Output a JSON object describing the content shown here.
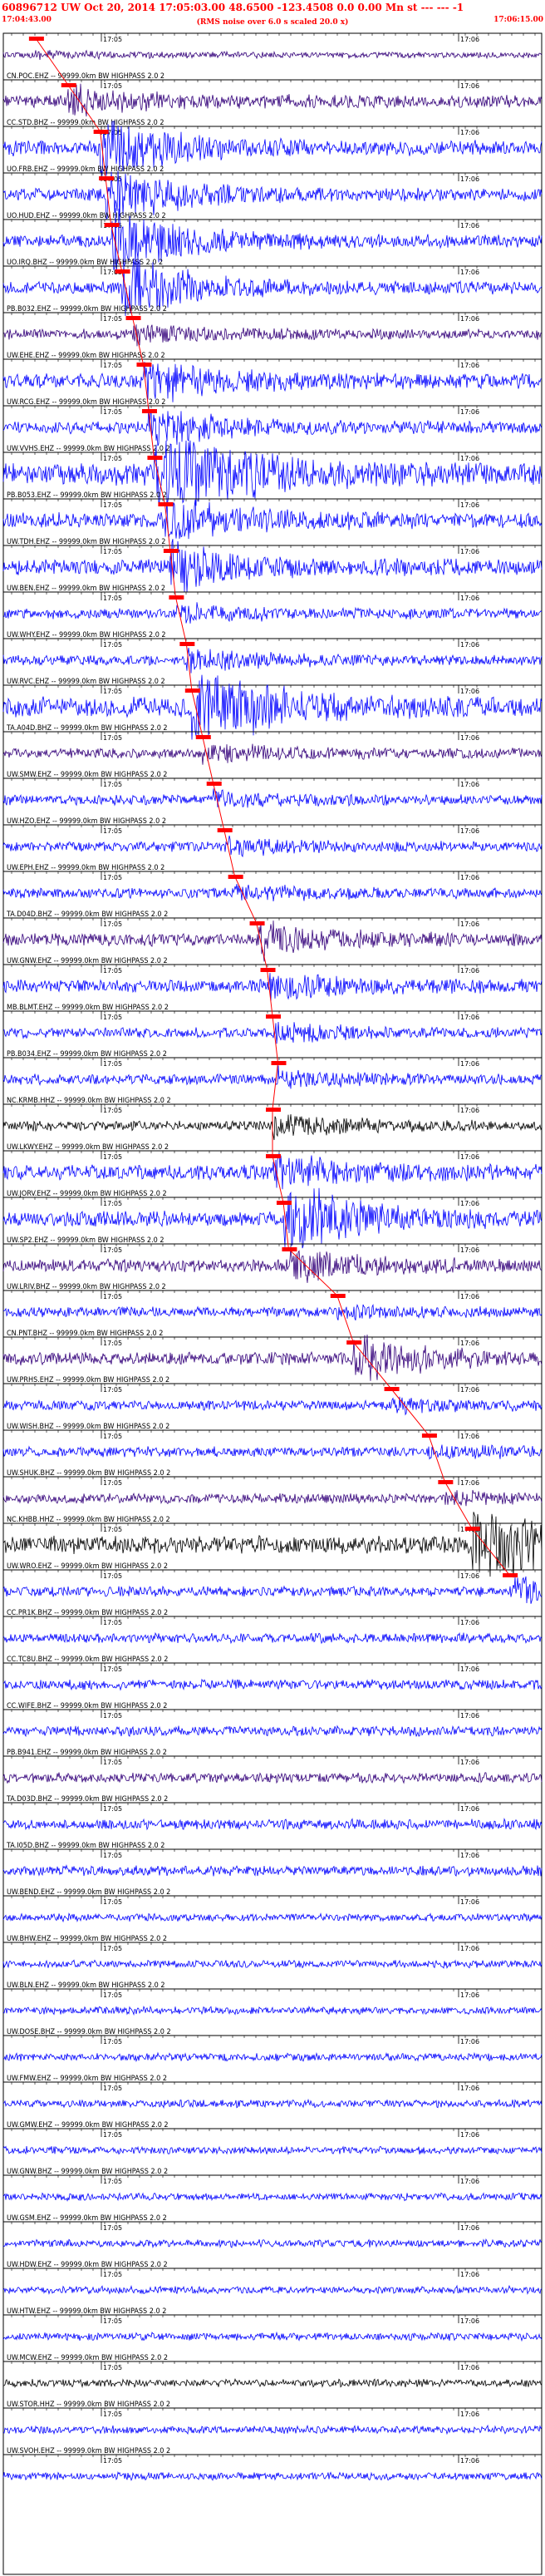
{
  "header": {
    "title": "60896712 UW Oct 20, 2014 17:05:03.00   48.6500 -123.4508  0.0 0.00 Mn st --- --- -1",
    "start_time": "17:04:43.00",
    "rms_note": "(RMS noise over 6.0 s scaled 20.0 x)",
    "end_time": "17:06:15.00"
  },
  "time_ticks": [
    "17:05",
    "17:06"
  ],
  "colors": {
    "header": "#ff0000",
    "pick": "#ff0000",
    "blue": "#0000ff",
    "black": "#000000",
    "purple": "#33007a"
  },
  "channels": [
    {
      "label": "",
      "color": "purple",
      "amp": 0.12,
      "pick": 0.06,
      "ev": 0.3
    },
    {
      "label": "CN.POC.EHZ -- 99999.0km BW HIGHPASS  2.0  2",
      "color": "purple",
      "amp": 0.25,
      "pick": 0.12,
      "ev": 0.6
    },
    {
      "label": "CC.STD.BHZ -- 99999.0km BW HIGHPASS  2.0  2",
      "color": "blue",
      "amp": 0.3,
      "pick": 0.18,
      "ev": 1.2
    },
    {
      "label": "UO.FRB.EHZ -- 99999.0km BW HIGHPASS  2.0  2",
      "color": "blue",
      "amp": 0.25,
      "pick": 0.19,
      "ev": 1.4
    },
    {
      "label": "UO.HUD.EHZ -- 99999.0km BW HIGHPASS  2.0  2",
      "color": "blue",
      "amp": 0.25,
      "pick": 0.2,
      "ev": 1.6
    },
    {
      "label": "UO.IRQ.BHZ -- 99999.0km BW HIGHPASS  2.0  2",
      "color": "blue",
      "amp": 0.25,
      "pick": 0.22,
      "ev": 1.5
    },
    {
      "label": "PB.B032.EHZ -- 99999.0km BW HIGHPASS  2.0  2",
      "color": "purple",
      "amp": 0.2,
      "pick": 0.24,
      "ev": 0.5
    },
    {
      "label": "UW.EHE.EHZ -- 99999.0km BW HIGHPASS  2.0  2",
      "color": "blue",
      "amp": 0.3,
      "pick": 0.26,
      "ev": 0.9
    },
    {
      "label": "UW.RCG.EHZ -- 99999.0km BW HIGHPASS  2.0  2",
      "color": "blue",
      "amp": 0.25,
      "pick": 0.27,
      "ev": 0.8
    },
    {
      "label": "UW.VVHS.EHZ -- 99999.0km BW HIGHPASS  2.0  2",
      "color": "blue",
      "amp": 0.45,
      "pick": 0.28,
      "ev": 1.6
    },
    {
      "label": "PB.B053.EHZ -- 99999.0km BW HIGHPASS  2.0  2",
      "color": "blue",
      "amp": 0.3,
      "pick": 0.3,
      "ev": 0.9
    },
    {
      "label": "UW.TDH.EHZ -- 99999.0km BW HIGHPASS  2.0  2",
      "color": "blue",
      "amp": 0.3,
      "pick": 0.31,
      "ev": 0.9
    },
    {
      "label": "UW.BEN.EHZ -- 99999.0km BW HIGHPASS  2.0  2",
      "color": "blue",
      "amp": 0.2,
      "pick": 0.32,
      "ev": 0.5
    },
    {
      "label": "UW.WHY.EHZ -- 99999.0km BW HIGHPASS  2.0  2",
      "color": "blue",
      "amp": 0.2,
      "pick": 0.34,
      "ev": 0.6
    },
    {
      "label": "UW.RVC.EHZ -- 99999.0km BW HIGHPASS  2.0  2",
      "color": "blue",
      "amp": 0.4,
      "pick": 0.35,
      "ev": 1.4
    },
    {
      "label": "TA.A04D.BHZ -- 99999.0km BW HIGHPASS  2.0  2",
      "color": "purple",
      "amp": 0.2,
      "pick": 0.37,
      "ev": 0.5
    },
    {
      "label": "UW.SMW.EHZ -- 99999.0km BW HIGHPASS  2.0  2",
      "color": "blue",
      "amp": 0.2,
      "pick": 0.39,
      "ev": 0.4
    },
    {
      "label": "UW.HZO.EHZ -- 99999.0km BW HIGHPASS  2.0  2",
      "color": "blue",
      "amp": 0.2,
      "pick": 0.41,
      "ev": 0.4
    },
    {
      "label": "UW.EPH.EHZ -- 99999.0km BW HIGHPASS  2.0  2",
      "color": "blue",
      "amp": 0.2,
      "pick": 0.43,
      "ev": 0.4
    },
    {
      "label": "TA.D04D.BHZ -- 99999.0km BW HIGHPASS  2.0  2",
      "color": "purple",
      "amp": 0.25,
      "pick": 0.47,
      "ev": 0.8
    },
    {
      "label": "UW.GNW.EHZ -- 99999.0km BW HIGHPASS  2.0  2",
      "color": "blue",
      "amp": 0.25,
      "pick": 0.49,
      "ev": 0.8
    },
    {
      "label": "MB.BLMT.EHZ -- 99999.0km BW HIGHPASS  2.0  2",
      "color": "blue",
      "amp": 0.2,
      "pick": 0.5,
      "ev": 0.5
    },
    {
      "label": "PB.B034.EHZ -- 99999.0km BW HIGHPASS  2.0  2",
      "color": "blue",
      "amp": 0.2,
      "pick": 0.51,
      "ev": 0.5
    },
    {
      "label": "NC.KRMB.HHZ -- 99999.0km BW HIGHPASS  2.0  2",
      "color": "black",
      "amp": 0.2,
      "pick": 0.5,
      "ev": 0.6
    },
    {
      "label": "UW.LKWY.EHZ -- 99999.0km BW HIGHPASS  2.0  2",
      "color": "blue",
      "amp": 0.3,
      "pick": 0.5,
      "ev": 0.6
    },
    {
      "label": "UW.JORV.EHZ -- 99999.0km BW HIGHPASS  2.0  2",
      "color": "blue",
      "amp": 0.3,
      "pick": 0.52,
      "ev": 1.6
    },
    {
      "label": "UW.SP2.EHZ -- 99999.0km BW HIGHPASS  2.0  2",
      "color": "purple",
      "amp": 0.25,
      "pick": 0.53,
      "ev": 0.8
    },
    {
      "label": "UW.LRIV.BHZ -- 99999.0km BW HIGHPASS  2.0  2",
      "color": "blue",
      "amp": 0.2,
      "pick": 0.62,
      "ev": 0.3
    },
    {
      "label": "CN.PNT.BHZ -- 99999.0km BW HIGHPASS  2.0  2",
      "color": "purple",
      "amp": 0.25,
      "pick": 0.65,
      "ev": 1.1
    },
    {
      "label": "UW.PRHS.EHZ -- 99999.0km BW HIGHPASS  2.0  2",
      "color": "blue",
      "amp": 0.2,
      "pick": 0.72,
      "ev": 0.3
    },
    {
      "label": "UW.WISH.BHZ -- 99999.0km BW HIGHPASS  2.0  2",
      "color": "blue",
      "amp": 0.2,
      "pick": 0.79,
      "ev": 0.3
    },
    {
      "label": "UW.SHUK.BHZ -- 99999.0km BW HIGHPASS  2.0  2",
      "color": "purple",
      "amp": 0.2,
      "pick": 0.82,
      "ev": 0.3
    },
    {
      "label": "NC.KHBB.HHZ -- 99999.0km BW HIGHPASS  2.0  2",
      "color": "black",
      "amp": 0.35,
      "pick": 0.87,
      "ev": 1.8
    },
    {
      "label": "UW.WRO.EHZ -- 99999.0km BW HIGHPASS  2.0  2",
      "color": "blue",
      "amp": 0.2,
      "pick": 0.94,
      "ev": 0.8
    },
    {
      "label": "CC.PR1K.BHZ -- 99999.0km BW HIGHPASS  2.0  2",
      "color": "blue",
      "amp": 0.2
    },
    {
      "label": "CC.TC8U.BHZ -- 99999.0km BW HIGHPASS  2.0  2",
      "color": "blue",
      "amp": 0.2
    },
    {
      "label": "CC.WIFE.BHZ -- 99999.0km BW HIGHPASS  2.0  2",
      "color": "blue",
      "amp": 0.2
    },
    {
      "label": "PB.B941.EHZ -- 99999.0km BW HIGHPASS  2.0  2",
      "color": "purple",
      "amp": 0.2
    },
    {
      "label": "TA.D03D.BHZ -- 99999.0km BW HIGHPASS  2.0  2",
      "color": "blue",
      "amp": 0.2
    },
    {
      "label": "TA.I05D.BHZ -- 99999.0km BW HIGHPASS  2.0  2",
      "color": "blue",
      "amp": 0.2
    },
    {
      "label": "UW.BEND.EHZ -- 99999.0km BW HIGHPASS  2.0  2",
      "color": "blue",
      "amp": 0.15
    },
    {
      "label": "UW.BHW.EHZ -- 99999.0km BW HIGHPASS  2.0  2",
      "color": "blue",
      "amp": 0.15
    },
    {
      "label": "UW.BLN.EHZ -- 99999.0km BW HIGHPASS  2.0  2",
      "color": "blue",
      "amp": 0.15
    },
    {
      "label": "UW.DOSE.BHZ -- 99999.0km BW HIGHPASS  2.0  2",
      "color": "blue",
      "amp": 0.15
    },
    {
      "label": "UW.FMW.EHZ -- 99999.0km BW HIGHPASS  2.0  2",
      "color": "blue",
      "amp": 0.15
    },
    {
      "label": "UW.GMW.EHZ -- 99999.0km BW HIGHPASS  2.0  2",
      "color": "blue",
      "amp": 0.15
    },
    {
      "label": "UW.GNW.BHZ -- 99999.0km BW HIGHPASS  2.0  2",
      "color": "blue",
      "amp": 0.15
    },
    {
      "label": "UW.GSM.EHZ -- 99999.0km BW HIGHPASS  2.0  2",
      "color": "blue",
      "amp": 0.15
    },
    {
      "label": "UW.HDW.EHZ -- 99999.0km BW HIGHPASS  2.0  2",
      "color": "blue",
      "amp": 0.15
    },
    {
      "label": "UW.HTW.EHZ -- 99999.0km BW HIGHPASS  2.0  2",
      "color": "blue",
      "amp": 0.15
    },
    {
      "label": "UW.MCW.EHZ -- 99999.0km BW HIGHPASS  2.0  2",
      "color": "black",
      "amp": 0.15
    },
    {
      "label": "UW.STOR.HHZ -- 99999.0km BW HIGHPASS  2.0  2",
      "color": "blue",
      "amp": 0.15
    },
    {
      "label": "UW.SVOH.EHZ -- 99999.0km BW HIGHPASS  2.0  2",
      "color": "blue",
      "amp": 0.15
    }
  ]
}
